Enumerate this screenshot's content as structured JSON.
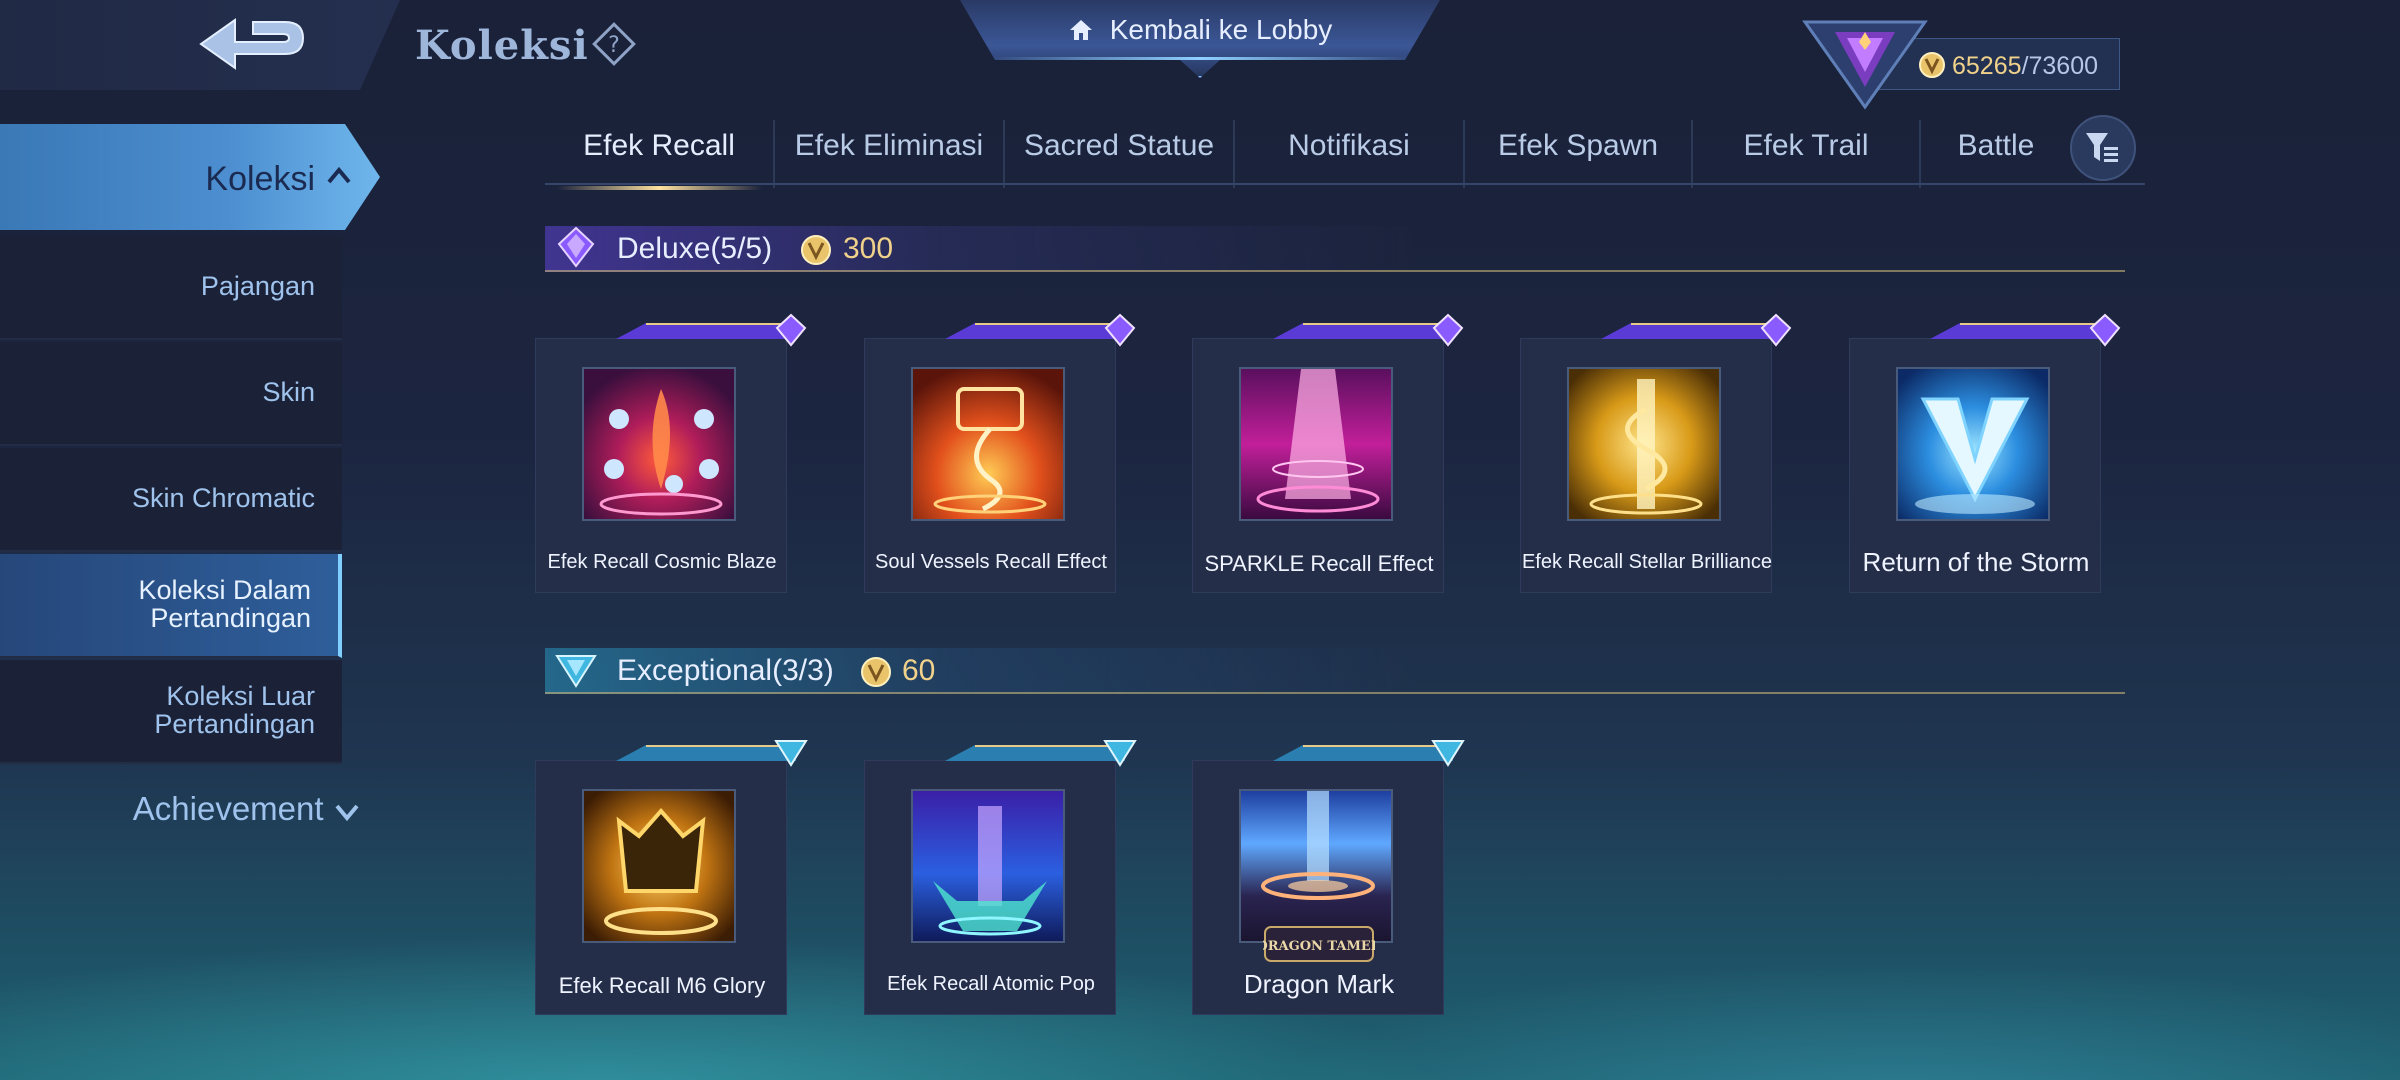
{
  "header": {
    "title": "Koleksi",
    "lobby_label": "Kembali ke Lobby",
    "points_current": "65265",
    "points_sep": "/",
    "points_max": "73600"
  },
  "sidebar": {
    "main_label": "Koleksi",
    "items": [
      {
        "label": "Pajangan"
      },
      {
        "label": "Skin"
      },
      {
        "label": "Skin Chromatic"
      },
      {
        "label_line1": "Koleksi Dalam",
        "label_line2": "Pertandingan",
        "active": true
      },
      {
        "label_line1": "Koleksi Luar",
        "label_line2": "Pertandingan"
      }
    ],
    "achievement_label": "Achievement"
  },
  "tabs": [
    {
      "label": "Efek Recall",
      "active": true
    },
    {
      "label": "Efek Eliminasi"
    },
    {
      "label": "Sacred Statue"
    },
    {
      "label": "Notifikasi"
    },
    {
      "label": "Efek Spawn"
    },
    {
      "label": "Efek Trail"
    },
    {
      "label": "Battle"
    }
  ],
  "sections": {
    "deluxe": {
      "name": "Deluxe",
      "count": "(5/5)",
      "cost": "300",
      "accent": "#8a5cff",
      "items": [
        {
          "name": "Efek Recall Cosmic Blaze"
        },
        {
          "name": "Soul Vessels Recall Effect"
        },
        {
          "name": "SPARKLE Recall Effect"
        },
        {
          "name": "Efek Recall Stellar Brilliance"
        },
        {
          "name": "Return of the Storm"
        }
      ]
    },
    "exceptional": {
      "name": "Exceptional",
      "count": "(3/3)",
      "cost": "60",
      "accent": "#3fb7e0",
      "items": [
        {
          "name": "Efek Recall M6 Glory"
        },
        {
          "name": "Efek Recall Atomic Pop"
        },
        {
          "name": "Dragon Mark",
          "logo_text": "DRAGON TAMER"
        }
      ]
    }
  },
  "icons": {
    "back": "back-arrow-icon",
    "help": "question-diamond-icon",
    "home": "home-icon",
    "coin": "coin-icon",
    "filter": "filter-list-icon",
    "chevron_up": "chevron-up-icon",
    "chevron_down": "chevron-down-icon"
  }
}
